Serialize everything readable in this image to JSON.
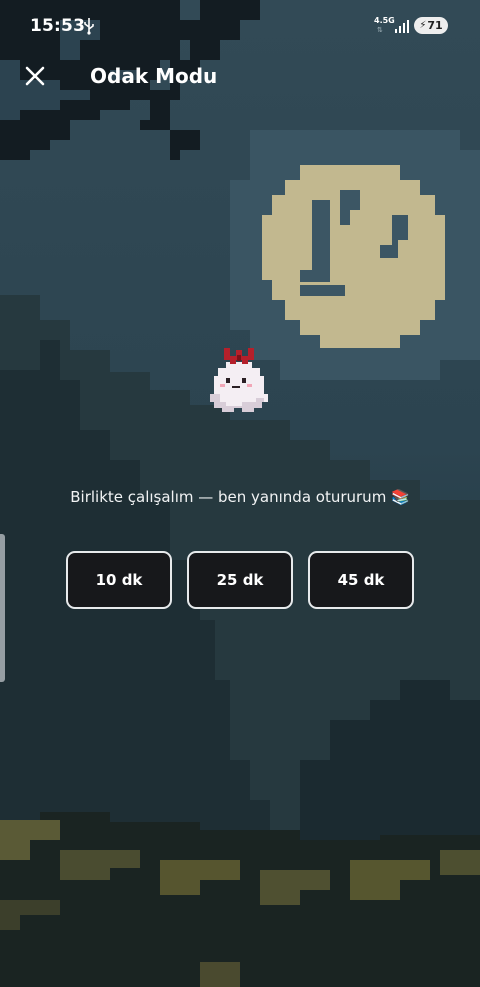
{
  "status_bar": {
    "time": "15:53",
    "network": "4.5G",
    "battery": "71",
    "icons": [
      "usb-icon",
      "signal-icon",
      "battery-charging-icon"
    ]
  },
  "header": {
    "title": "Odak Modu",
    "close_icon": "close-icon"
  },
  "companion": {
    "icon": "ghost-with-bow-icon"
  },
  "message": "Birlikte çalışalım — ben yanında otururum 📚",
  "durations": [
    {
      "label": "10 dk"
    },
    {
      "label": "25 dk"
    },
    {
      "label": "45 dk"
    }
  ],
  "colors": {
    "sky": "#2c4350",
    "moon": "#c2b88f",
    "button_bg": "#17181b",
    "button_border": "#e7eaec"
  }
}
